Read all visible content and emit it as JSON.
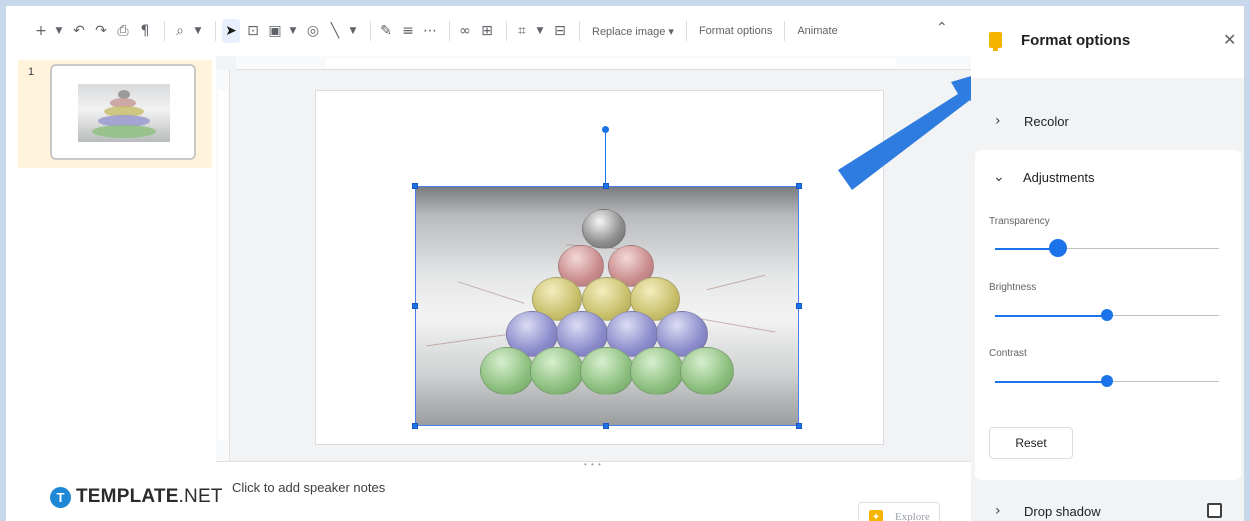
{
  "toolbar": {
    "replace_image_label": "Replace image ▾",
    "format_options_label": "Format options",
    "animate_label": "Animate",
    "icons": [
      "plus-icon",
      "dropdown-caret-icon",
      "undo-icon",
      "redo-icon",
      "print-icon",
      "paint-format-icon",
      "zoom-icon",
      "dropdown-caret-icon",
      "cursor-icon",
      "text-box-icon",
      "image-icon",
      "dropdown-caret-icon",
      "shape-icon",
      "line-icon",
      "dropdown-caret-icon",
      "pen-icon",
      "border-weight-icon",
      "border-dash-icon",
      "link-icon",
      "comment-icon",
      "crop-icon",
      "dropdown-caret-icon",
      "mask-image-icon"
    ],
    "collapse_icon": "chevron-up-icon"
  },
  "filmstrip": {
    "slide_number": "1"
  },
  "notes": {
    "placeholder": "Click to add speaker notes",
    "explore_label": "Explore"
  },
  "logo": {
    "letter": "T",
    "brand": "TEMPLATE",
    "suffix": ".NET"
  },
  "panel": {
    "title": "Format options",
    "close_glyph": "✕",
    "recolor_label": "Recolor",
    "adjustments_label": "Adjustments",
    "transparency_label": "Transparency",
    "brightness_label": "Brightness",
    "contrast_label": "Contrast",
    "transparency_value": 0.28,
    "brightness_value": 0.5,
    "contrast_value": 0.5,
    "reset_label": "Reset",
    "drop_shadow_label": "Drop shadow",
    "drop_shadow_checked": false
  },
  "colors": {
    "accent": "#1a73e8",
    "callout_arrow": "#2f7ce0",
    "panel_icon": "#f4b400",
    "slide_selected_bg": "#fff3dc",
    "border_frame": "#c9d7ea"
  }
}
